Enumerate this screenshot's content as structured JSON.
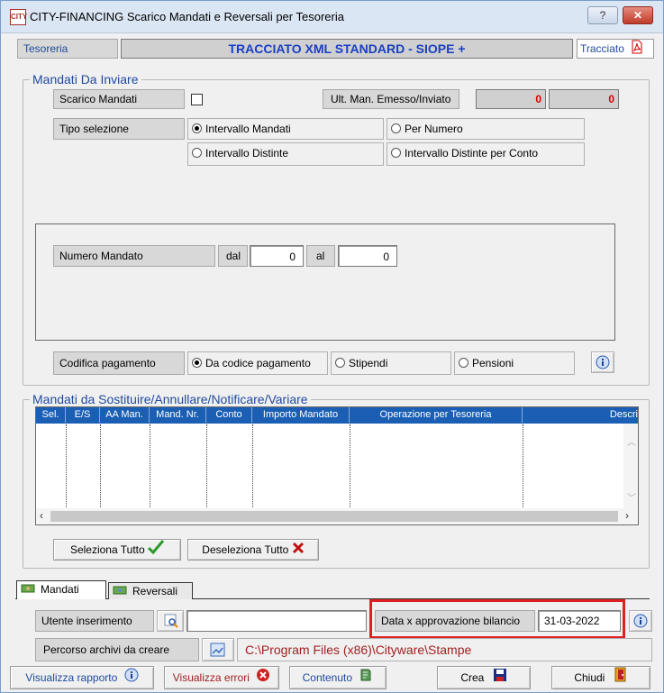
{
  "window": {
    "app_icon_text": "CITY",
    "title": "CITY-FINANCING  Scarico Mandati e Reversali per Tesoreria",
    "help_label": "?",
    "close_label": "✕"
  },
  "tesoreria": {
    "label": "Tesoreria",
    "value": "TRACCIATO XML STANDARD - SIOPE +",
    "tracciato_label": "Tracciato"
  },
  "mandati_da_inviare": {
    "title": "Mandati Da Inviare",
    "scarico_label": "Scarico Mandati",
    "ult_label": "Ult. Man. Emesso/Inviato",
    "ult_value_1": "0",
    "ult_value_2": "0",
    "tipo_selezione_label": "Tipo selezione",
    "tipo_options": [
      "Intervallo Mandati",
      "Per Numero",
      "Intervallo Distinte",
      "Intervallo Distinte per Conto"
    ],
    "numero_mandato_label": "Numero Mandato",
    "dal_label": "dal",
    "dal_value": "0",
    "al_label": "al",
    "al_value": "0",
    "codifica_label": "Codifica pagamento",
    "codifica_options": [
      "Da codice pagamento",
      "Stipendi",
      "Pensioni"
    ]
  },
  "sostituire": {
    "title": "Mandati da Sostituire/Annullare/Notificare/Variare",
    "columns": [
      "Sel.",
      "E/S",
      "AA Man.",
      "Mand. Nr.",
      "Conto",
      "Importo Mandato",
      "Operazione per Tesoreria",
      "Descri"
    ],
    "seleziona_label": "Seleziona Tutto",
    "deseleziona_label": "Deseleziona Tutto"
  },
  "tabs": [
    "Mandati",
    "Reversali"
  ],
  "bottom": {
    "utente_label": "Utente inserimento",
    "utente_value": "",
    "data_label": "Data x approvazione bilancio",
    "data_value": "31-03-2022",
    "percorso_label": "Percorso archivi da creare",
    "percorso_value": "C:\\Program Files (x86)\\Cityware\\Stampe"
  },
  "footer": {
    "visualizza_rapporto": "Visualizza rapporto",
    "visualizza_errori": "Visualizza errori",
    "contenuto": "Contenuto",
    "crea": "Crea",
    "chiudi": "Chiudi"
  },
  "colors": {
    "accent_blue": "#1f4a9c",
    "header_blue": "#1a5fb4",
    "highlight_red": "#e02020",
    "path_red": "#a02020"
  }
}
